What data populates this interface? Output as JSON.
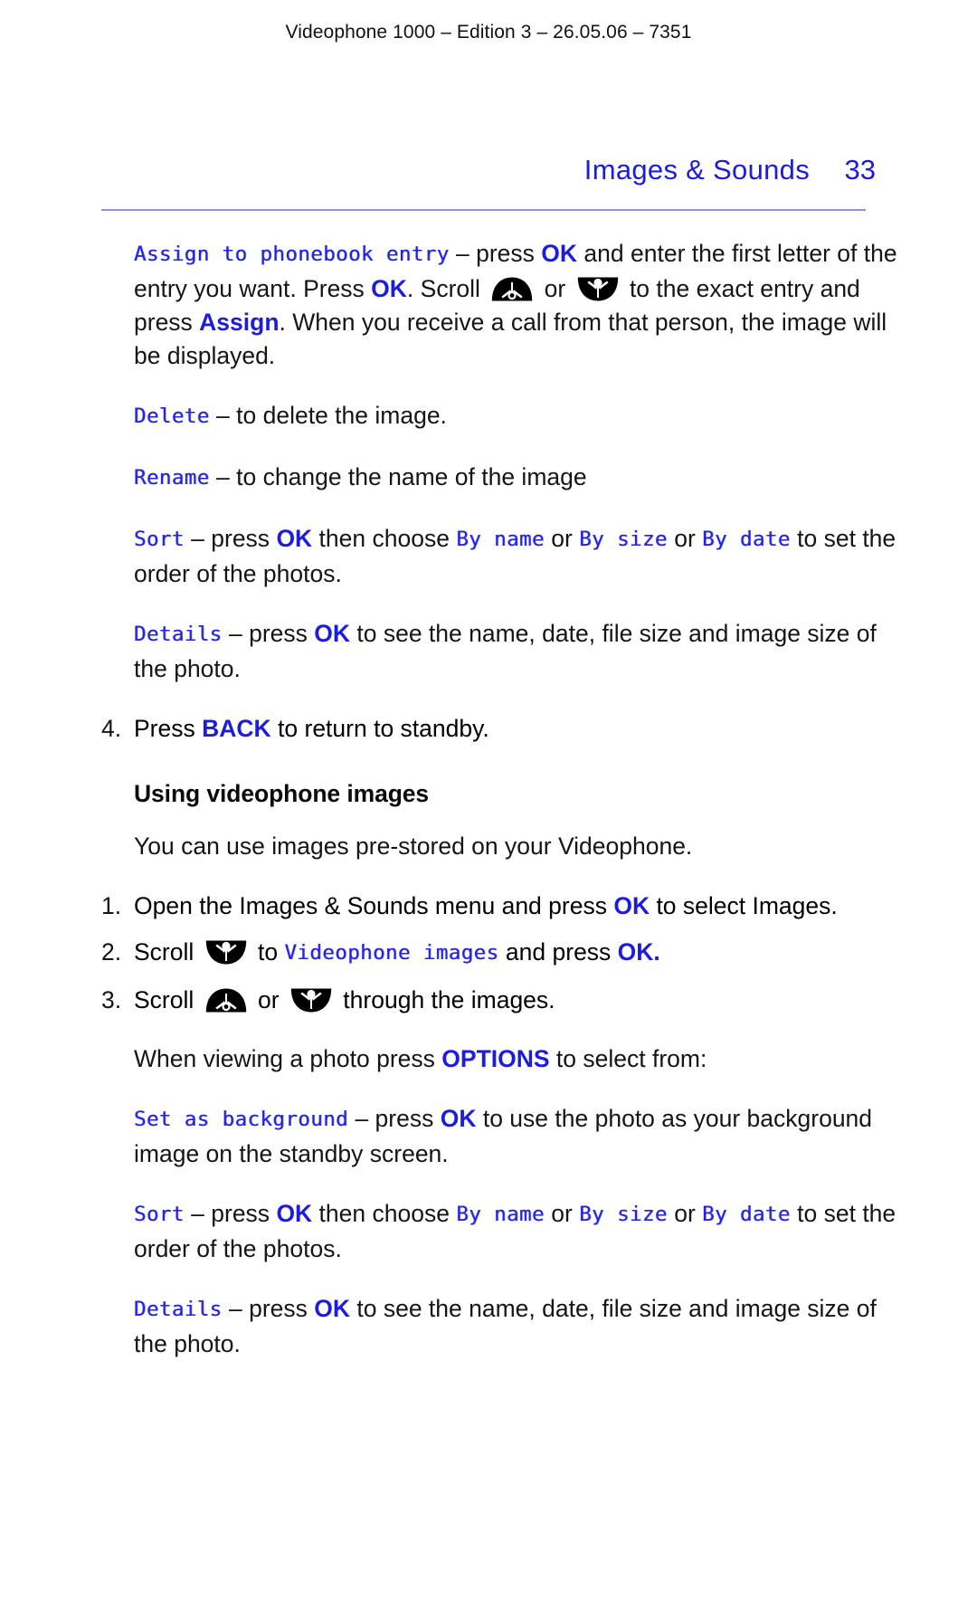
{
  "document": {
    "running_head": "Videophone 1000 – Edition 3 – 26.05.06 – 7351",
    "chapter_title": "Images & Sounds",
    "page_number": "33",
    "accent_color": "#1b1ce0",
    "lcd_color": "#2222e6",
    "rule_color": "#8f8fe8"
  },
  "icons": {
    "scroll_up": "scroll-up-key-icon",
    "scroll_down": "scroll-down-key-icon"
  },
  "options_list": {
    "assign": {
      "menu_label": "Assign to phonebook entry",
      "t1": " – press ",
      "key1": "OK",
      "t2": " and enter the first letter of the entry you want. Press ",
      "key2": "OK",
      "t3": ". Scroll ",
      "t4": " or ",
      "t5": " to the exact entry and press ",
      "key3": "Assign",
      "t6": ". When you receive a call from that person, the image will be displayed."
    },
    "delete": {
      "menu_label": "Delete",
      "t1": " – to delete the image."
    },
    "rename": {
      "menu_label": "Rename",
      "t1": " – to change the name of the image"
    },
    "sort": {
      "menu_label": "Sort",
      "t1": " – press ",
      "key1": "OK",
      "t2": " then choose ",
      "opt1": "By name",
      "t3": " or ",
      "opt2": "By size",
      "t4": " or ",
      "opt3": "By date",
      "t5": " to set the order of the photos."
    },
    "details": {
      "menu_label": "Details",
      "t1": " – press ",
      "key1": "OK",
      "t2": " to see the name, date, file size and image size of the photo."
    },
    "step4": {
      "number": "4.",
      "t1": "Press ",
      "key1": "BACK",
      "t2": " to return to standby."
    }
  },
  "using_images": {
    "heading": "Using videophone images",
    "intro": "You can use images pre-stored on your Videophone.",
    "step1": {
      "number": "1.",
      "t1": "Open the Images & Sounds menu and press ",
      "key1": "OK",
      "t2": " to select Images."
    },
    "step2": {
      "number": "2.",
      "t1": "Scroll ",
      "t2": " to ",
      "menu_label": "Videophone images",
      "t3": " and press ",
      "key1": "OK."
    },
    "step3": {
      "number": "3.",
      "t1": "Scroll ",
      "t2": " or ",
      "t3": " through the images."
    },
    "options_intro": {
      "t1": "When viewing a photo press ",
      "key1": "OPTIONS",
      "t2": " to select from:"
    },
    "set_as_background": {
      "menu_label": "Set as background",
      "t1": " – press ",
      "key1": "OK",
      "t2": " to use the photo as your background image on the standby screen."
    },
    "sort": {
      "menu_label": "Sort",
      "t1": " – press ",
      "key1": "OK",
      "t2": " then choose ",
      "opt1": "By name",
      "t3": " or ",
      "opt2": "By size",
      "t4": " or ",
      "opt3": "By date",
      "t5": " to set the order of the photos."
    },
    "details": {
      "menu_label": "Details",
      "t1": " – press ",
      "key1": "OK",
      "t2": " to see the name, date, file size and image size of the photo."
    }
  }
}
